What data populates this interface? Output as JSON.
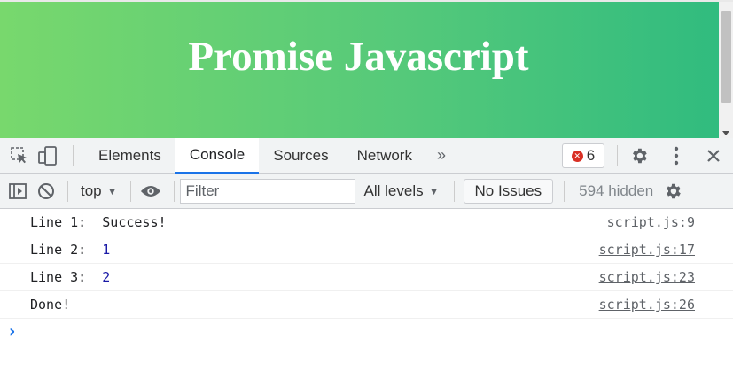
{
  "page": {
    "title": "Promise Javascript"
  },
  "devtools": {
    "tabs": [
      {
        "label": "Elements"
      },
      {
        "label": "Console"
      },
      {
        "label": "Sources"
      },
      {
        "label": "Network"
      }
    ],
    "more_tabs": "»",
    "error_count": "6",
    "toolbar": {
      "context": "top",
      "filter_placeholder": "Filter",
      "levels": "All levels",
      "issues": "No Issues",
      "hidden": "594 hidden"
    },
    "messages": [
      {
        "label": "Line 1:  ",
        "value": "Success!",
        "value_color": "#202124",
        "source": "script.js:9"
      },
      {
        "label": "Line 2:  ",
        "value": "1",
        "value_color": "#1a1aa6",
        "source": "script.js:17"
      },
      {
        "label": "Line 3:  ",
        "value": "2",
        "value_color": "#1a1aa6",
        "source": "script.js:23"
      },
      {
        "label": "Done!",
        "value": "",
        "value_color": "#202124",
        "source": "script.js:26"
      }
    ],
    "prompt": "›"
  },
  "colors": {
    "accent": "#1a73e8",
    "error": "#d93025",
    "gradient_start": "#78d86d",
    "gradient_end": "#2fbb7f"
  },
  "icons": {
    "inspect": "inspect-element-icon",
    "device": "device-toolbar-icon",
    "settings": "gear-icon",
    "menu": "kebab-menu-icon",
    "close": "close-icon",
    "sidebar": "console-sidebar-icon",
    "clear": "clear-console-icon",
    "eye": "eye-icon"
  }
}
